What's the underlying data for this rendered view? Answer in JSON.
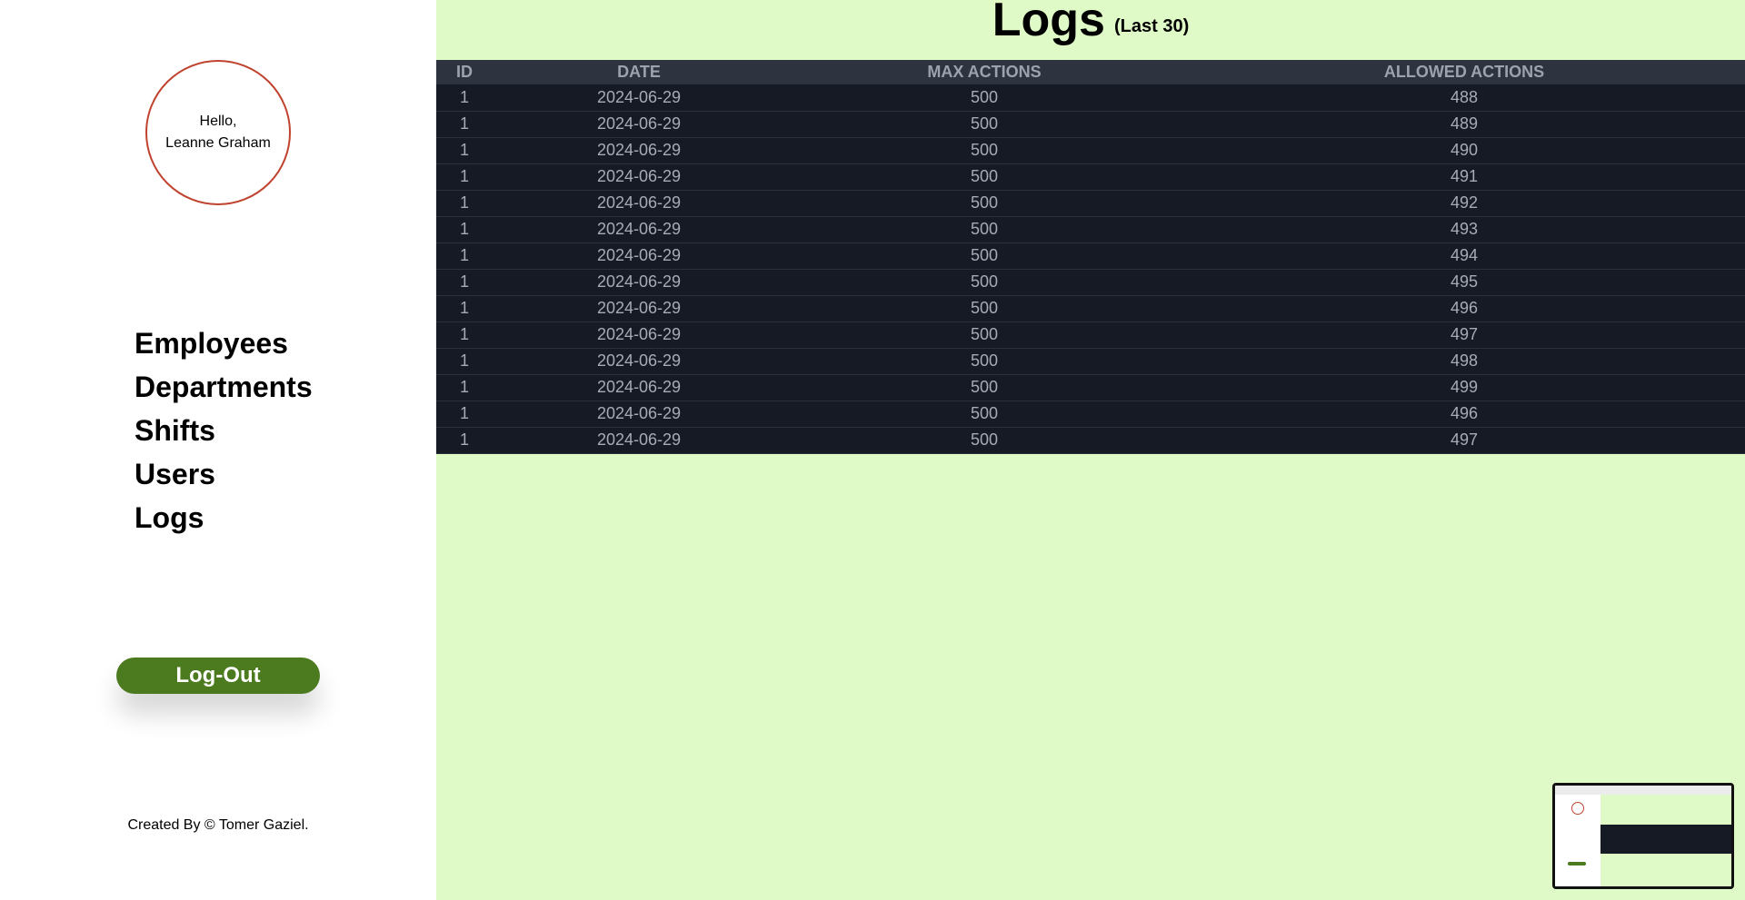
{
  "sidebar": {
    "greeting": {
      "hello": "Hello,",
      "name": "Leanne Graham"
    },
    "nav": [
      {
        "label": "Employees"
      },
      {
        "label": "Departments"
      },
      {
        "label": "Shifts"
      },
      {
        "label": "Users"
      },
      {
        "label": "Logs"
      }
    ],
    "logout_label": "Log-Out",
    "footer": "Created By © Tomer Gaziel."
  },
  "main": {
    "title": "Logs",
    "subtitle": "(Last 30)",
    "table": {
      "headers": [
        "ID",
        "DATE",
        "MAX ACTIONS",
        "ALLOWED ACTIONS"
      ],
      "rows": [
        [
          "1",
          "2024-06-29",
          "500",
          "488"
        ],
        [
          "1",
          "2024-06-29",
          "500",
          "489"
        ],
        [
          "1",
          "2024-06-29",
          "500",
          "490"
        ],
        [
          "1",
          "2024-06-29",
          "500",
          "491"
        ],
        [
          "1",
          "2024-06-29",
          "500",
          "492"
        ],
        [
          "1",
          "2024-06-29",
          "500",
          "493"
        ],
        [
          "1",
          "2024-06-29",
          "500",
          "494"
        ],
        [
          "1",
          "2024-06-29",
          "500",
          "495"
        ],
        [
          "1",
          "2024-06-29",
          "500",
          "496"
        ],
        [
          "1",
          "2024-06-29",
          "500",
          "497"
        ],
        [
          "1",
          "2024-06-29",
          "500",
          "498"
        ],
        [
          "1",
          "2024-06-29",
          "500",
          "499"
        ],
        [
          "1",
          "2024-06-29",
          "500",
          "496"
        ],
        [
          "1",
          "2024-06-29",
          "500",
          "497"
        ]
      ]
    }
  },
  "colors": {
    "main_background": "#dffac7",
    "greeting_border": "#c0432f",
    "logout_button": "#4b7a1f",
    "table_header": "#2d333f",
    "table_row": "#161a24"
  }
}
